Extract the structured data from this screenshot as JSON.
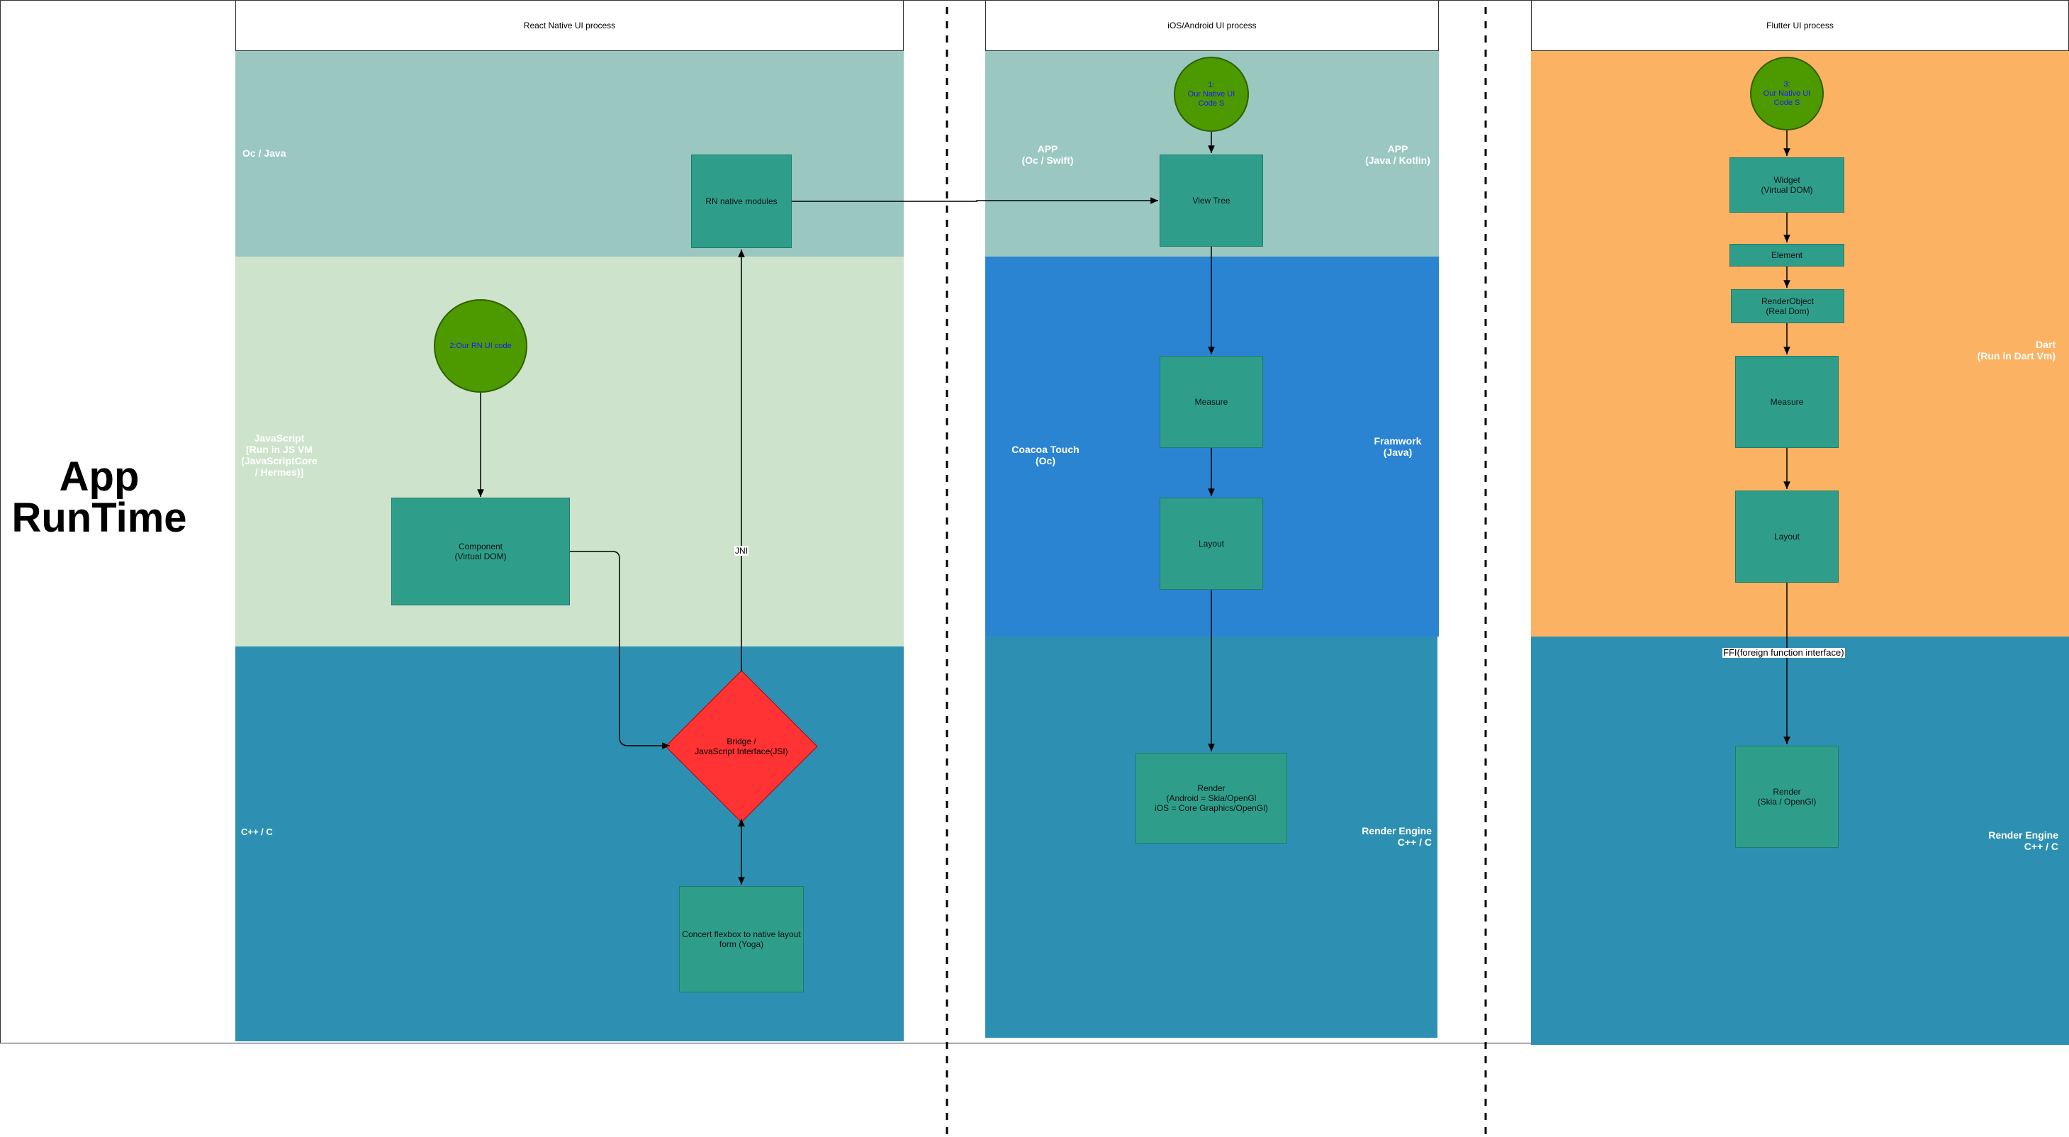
{
  "title": "App\nRunTime",
  "lanes": {
    "react_native": "React Native UI process",
    "native": "iOS/Android UI process",
    "flutter": "Flutter UI process"
  },
  "rn": {
    "band_oc_java": "Oc / Java",
    "band_js": "JavaScript\n[Run in JS VM\n(JavaScriptCore\n/ Hermes)]",
    "band_cpp": "C++ / C",
    "native_modules": "RN native modules",
    "rn_ui_code": "2:Our RN UI code",
    "component": "Component\n(Virtual DOM)",
    "bridge": "Bridge /\nJavaScript Interface(JSI)",
    "yoga": "Concert flexbox  to native layout\nform (Yoga)",
    "jni": "JNI"
  },
  "native": {
    "app_ios": "APP\n(Oc / Swift)",
    "app_android": "APP\n(Java / Kotlin)",
    "code_circle": "1:\nOur Native UI\nCode S",
    "view_tree": "View Tree",
    "cocoa": "Coacoa Touch\n(Oc)",
    "framework": "Framwork\n(Java)",
    "measure": "Measure",
    "layout": "Layout",
    "render": "Render\n(Android = Skia/OpenGl\niOS = Core Graphics/OpenGl)",
    "render_engine": "Render Engine\nC++ / C"
  },
  "flutter": {
    "code_circle": "3:\nOur Native UI\nCode S",
    "widget": "Widget\n(Virtual DOM)",
    "element": "Element",
    "render_object": "RenderObject\n(Real Dom)",
    "measure": "Measure",
    "layout": "Layout",
    "dart": "Dart\n(Run in Dart Vm)",
    "ffi": "FFI(foreign function interface)",
    "render": "Render\n(Skia / OpenGl)",
    "render_engine": "Render Engine\nC++ / C"
  },
  "colors": {
    "band_top": "#9ac8c0",
    "band_js": "#cde3cb",
    "band_cpp": "#2d90b2",
    "band_framework": "#2a84d2",
    "band_dart": "#fcb263",
    "node": "#2e9e8a",
    "circle": "#4d9900",
    "diamond": "#ff3333"
  }
}
